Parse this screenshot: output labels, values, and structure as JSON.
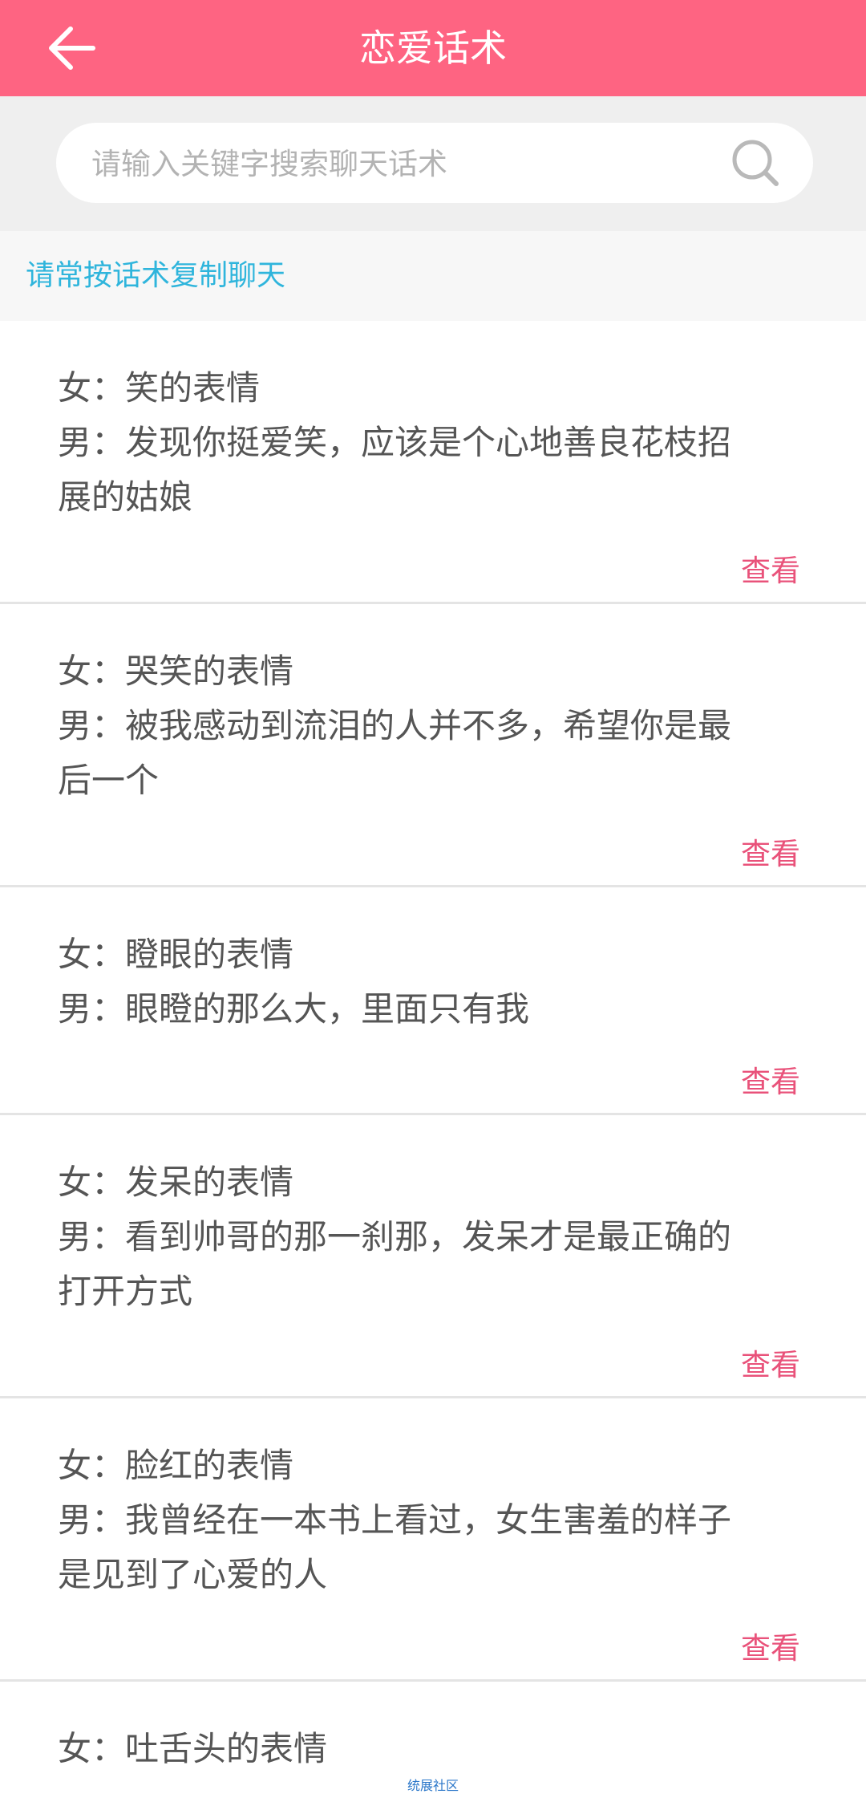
{
  "header": {
    "title": "恋爱话术"
  },
  "search": {
    "placeholder": "请输入关键字搜索聊天话术",
    "value": ""
  },
  "tip": "请常按话术复制聊天",
  "view_label": "查看",
  "items": [
    {
      "female": "女：笑的表情",
      "male_line1": "男：发现你挺爱笑，应该是个心地善良花枝招",
      "male_line2": "展的姑娘"
    },
    {
      "female": "女：哭笑的表情",
      "male_line1": "男：被我感动到流泪的人并不多，希望你是最",
      "male_line2": "后一个"
    },
    {
      "female": "女：瞪眼的表情",
      "male_line1": "男：眼瞪的那么大，里面只有我",
      "male_line2": ""
    },
    {
      "female": "女：发呆的表情",
      "male_line1": "男：看到帅哥的那一刹那，发呆才是最正确的",
      "male_line2": "打开方式"
    },
    {
      "female": "女：脸红的表情",
      "male_line1": "男：我曾经在一本书上看过，女生害羞的样子",
      "male_line2": "是见到了心爱的人"
    },
    {
      "female": "女：吐舌头的表情",
      "male_line1": "",
      "male_line2": ""
    }
  ],
  "watermark": "统展社区"
}
